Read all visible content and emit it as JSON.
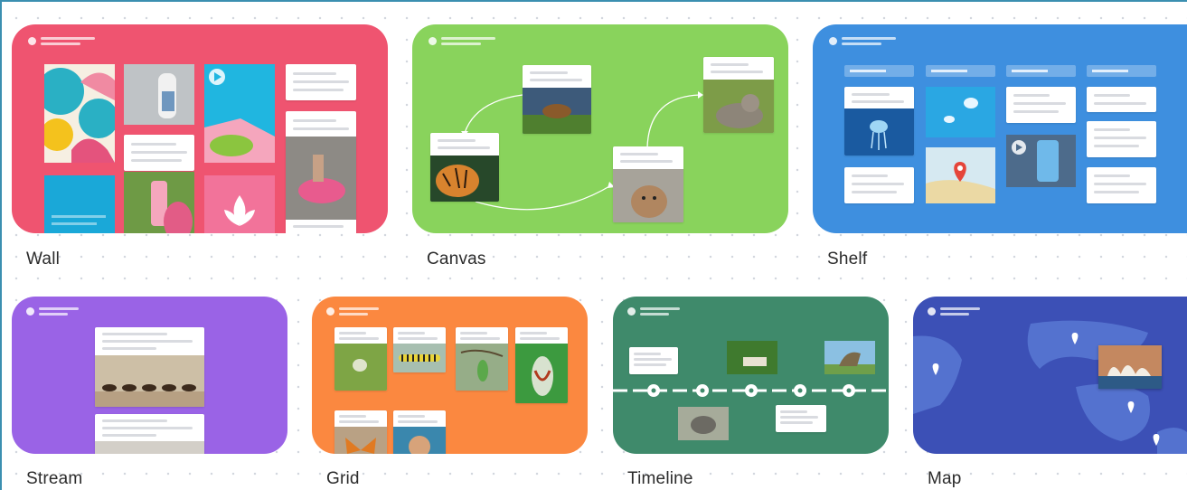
{
  "page": {
    "background": "#ffffff"
  },
  "templates": [
    {
      "id": "wall",
      "label": "Wall",
      "color": "#ef5470"
    },
    {
      "id": "canvas",
      "label": "Canvas",
      "color": "#89d35c"
    },
    {
      "id": "shelf",
      "label": "Shelf",
      "color": "#3e8fdf"
    },
    {
      "id": "stream",
      "label": "Stream",
      "color": "#9a63e6"
    },
    {
      "id": "grid",
      "label": "Grid",
      "color": "#fb8840"
    },
    {
      "id": "timeline",
      "label": "Timeline",
      "color": "#3f8a6b"
    },
    {
      "id": "map",
      "label": "Map",
      "color": "#3c50b6"
    }
  ]
}
